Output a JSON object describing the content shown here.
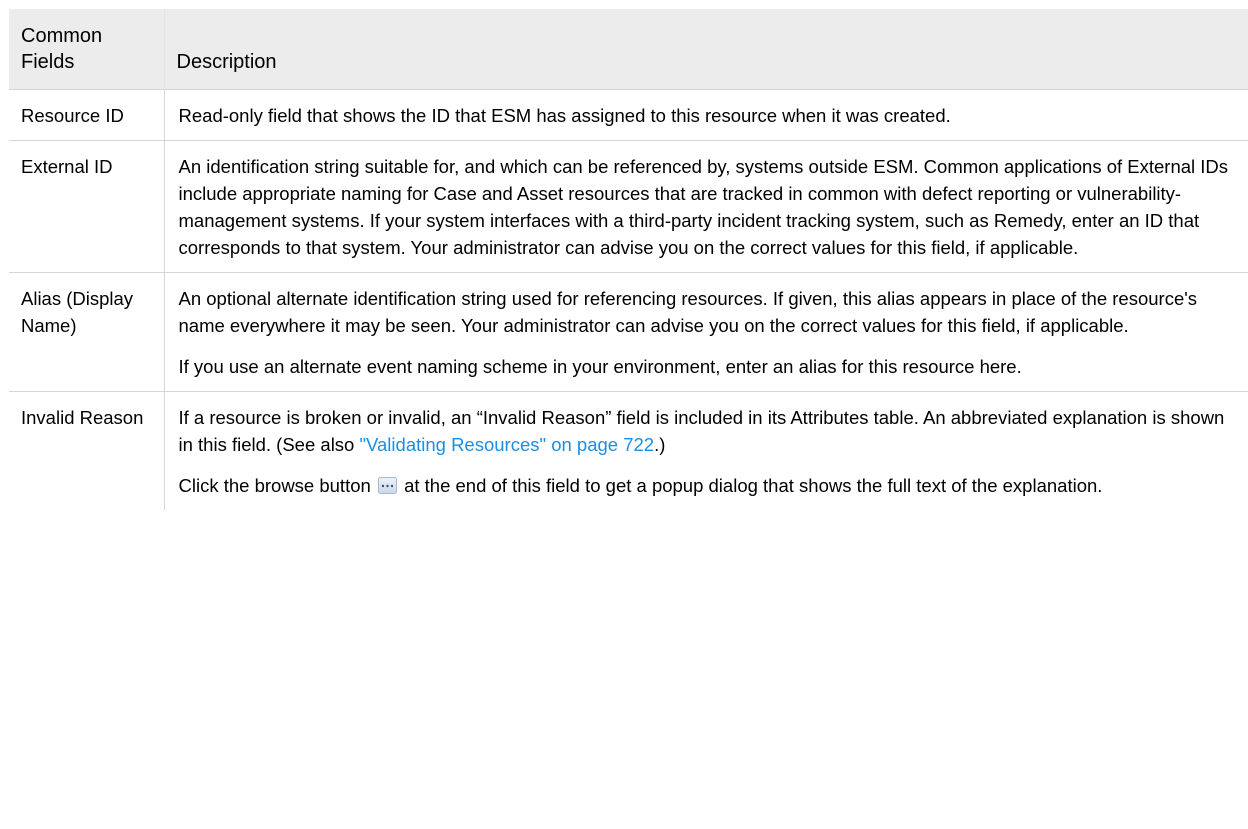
{
  "table": {
    "headers": {
      "field": "Common Fields",
      "description": "Description"
    },
    "rows": [
      {
        "field": "Resource ID",
        "description": "Read-only field that shows the ID that ESM has assigned to this resource when it was created."
      },
      {
        "field": "External ID",
        "description": "An identification string suitable for, and which can be referenced by, systems outside ESM. Common applications of External IDs include appropriate naming for Case and Asset resources that are tracked in common with defect reporting or vulnerability-management systems. If your system interfaces with a third-party incident tracking system, such as Remedy, enter an ID that corresponds to that system. Your administrator can advise you on the correct values for this field, if applicable."
      },
      {
        "field": "Alias (Display Name)",
        "description": "An optional alternate identification string used for referencing resources. If given, this alias appears in place of the resource's name everywhere it may be seen. Your administrator can advise you on the correct values for this field, if applicable.",
        "description_2": "If you use an alternate event naming scheme in your environment, enter an alias for this resource here."
      },
      {
        "field": "Invalid Reason",
        "description_before_link": "If a resource is broken or invalid, an “Invalid Reason” field is included in its Attributes table. An abbreviated explanation is shown in this field. (See also ",
        "link_text": "\"Validating Resources\" on page 722",
        "description_after_link": ".)",
        "description_2_before_icon": "Click the browse button ",
        "browse_icon": "ellipsis-browse-icon",
        "description_2_after_icon": " at the end of this field to get a popup dialog that shows the full text of the explanation."
      }
    ]
  },
  "colors": {
    "header_background": "#ececec",
    "link": "#1a8fe3",
    "border": "#d6d6d6"
  }
}
